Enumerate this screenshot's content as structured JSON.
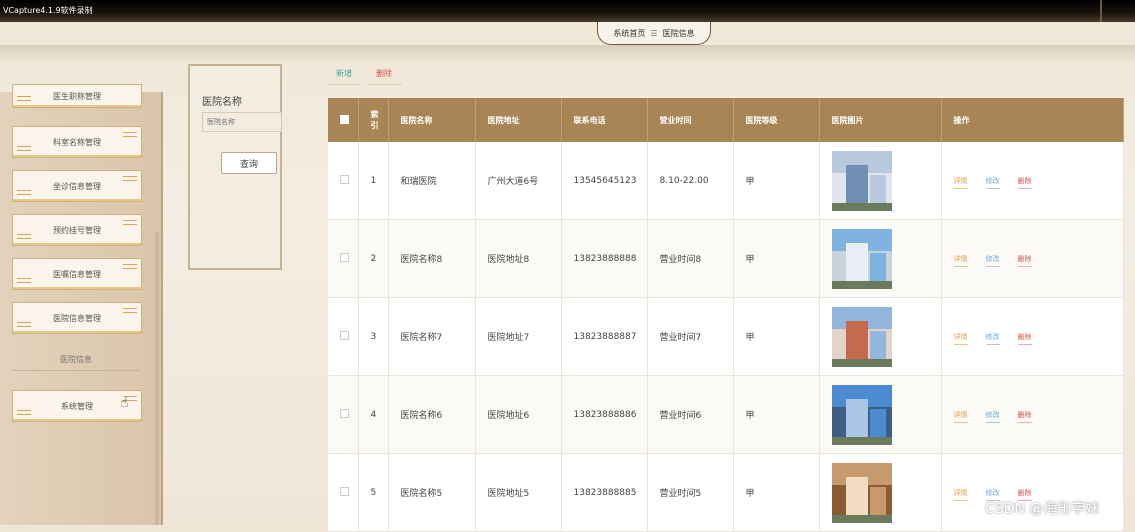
{
  "recorder_title": "VCapture4.1.9软件录制",
  "breadcrumb": {
    "home": "系统首页",
    "separator": "☰",
    "current": "医院信息"
  },
  "sidebar": {
    "items": [
      "医生职称管理",
      "科室名称管理",
      "坐诊信息管理",
      "预约挂号管理",
      "医嘱信息管理",
      "医院信息管理"
    ],
    "sub_label": "医院信息",
    "system": "系统管理"
  },
  "search": {
    "label": "医院名称",
    "placeholder": "医院名称",
    "button": "查询"
  },
  "actions": {
    "add": "新增",
    "delete": "删除"
  },
  "table": {
    "headers": [
      "索引",
      "医院名称",
      "医院地址",
      "联系电话",
      "营业时间",
      "医院等级",
      "医院图片",
      "操作"
    ],
    "header_index_lines": [
      "索",
      "引"
    ],
    "ops": {
      "detail": "详情",
      "edit": "修改",
      "delete": "删除"
    },
    "rows": [
      {
        "index": "1",
        "name": "和瑞医院",
        "address": "广州大道6号",
        "phone": "13545645123",
        "hours": "8.10-22.00",
        "level": "甲"
      },
      {
        "index": "2",
        "name": "医院名称8",
        "address": "医院地址8",
        "phone": "13823888888",
        "hours": "营业时间8",
        "level": "甲"
      },
      {
        "index": "3",
        "name": "医院名称7",
        "address": "医院地址7",
        "phone": "13823888887",
        "hours": "营业时间7",
        "level": "甲"
      },
      {
        "index": "4",
        "name": "医院名称6",
        "address": "医院地址6",
        "phone": "13823888886",
        "hours": "营业时间6",
        "level": "甲"
      },
      {
        "index": "5",
        "name": "医院名称5",
        "address": "医院地址5",
        "phone": "13823888885",
        "hours": "营业时间5",
        "level": "甲"
      }
    ]
  },
  "watermark": "CSDN @海彤学妹",
  "colors": {
    "header_bg": "#a98454",
    "add": "#3fa9a0",
    "delete": "#d9534f",
    "detail": "#e0a040",
    "edit": "#6ea7d8"
  }
}
